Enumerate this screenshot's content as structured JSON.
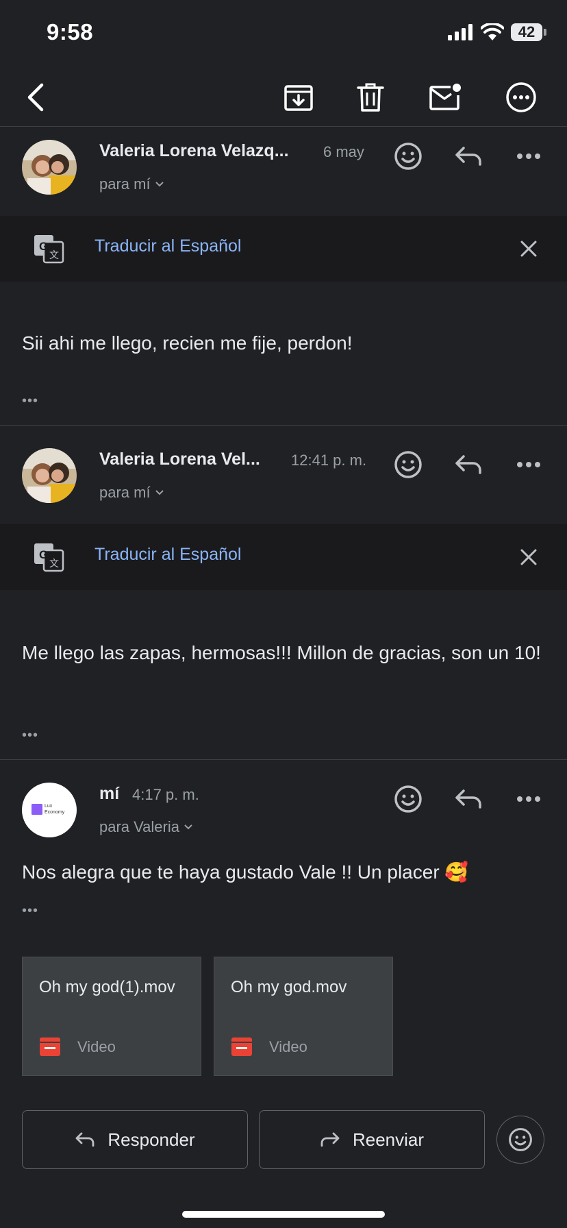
{
  "status_bar": {
    "time": "9:58",
    "battery": "42"
  },
  "toolbar": {
    "icons": [
      "back-icon",
      "archive-icon",
      "delete-icon",
      "mark-unread-icon",
      "more-options-icon"
    ]
  },
  "messages": [
    {
      "sender": "Valeria Lorena Velazq...",
      "date": "6 may",
      "recipient": "para mí",
      "translate_label": "Traducir al Español",
      "body": "Sii ahi me llego, recien me fije, perdon!",
      "more": "•••"
    },
    {
      "sender": "Valeria Lorena Vel...",
      "date": "12:41 p. m.",
      "recipient": "para mí",
      "translate_label": "Traducir al Español",
      "body": "Me llego las zapas, hermosas!!! Millon de gracias, son un 10!",
      "more": "•••"
    },
    {
      "sender": "mí",
      "date": "4:17 p. m.",
      "recipient": "para Valeria",
      "avatar_text": "Lux Economy",
      "body": "Nos alegra que te haya gustado Vale !! Un placer 🥰",
      "more": "•••"
    }
  ],
  "attachments": [
    {
      "name": "Oh my god(1).mov",
      "type": "Video"
    },
    {
      "name": "Oh my god.mov",
      "type": "Video"
    }
  ],
  "actions": {
    "reply": "Responder",
    "forward": "Reenviar"
  },
  "colors": {
    "background": "#202124",
    "link": "#8ab4f8",
    "video_icon": "#ea4335",
    "brand_square": "#8b5cf6"
  }
}
